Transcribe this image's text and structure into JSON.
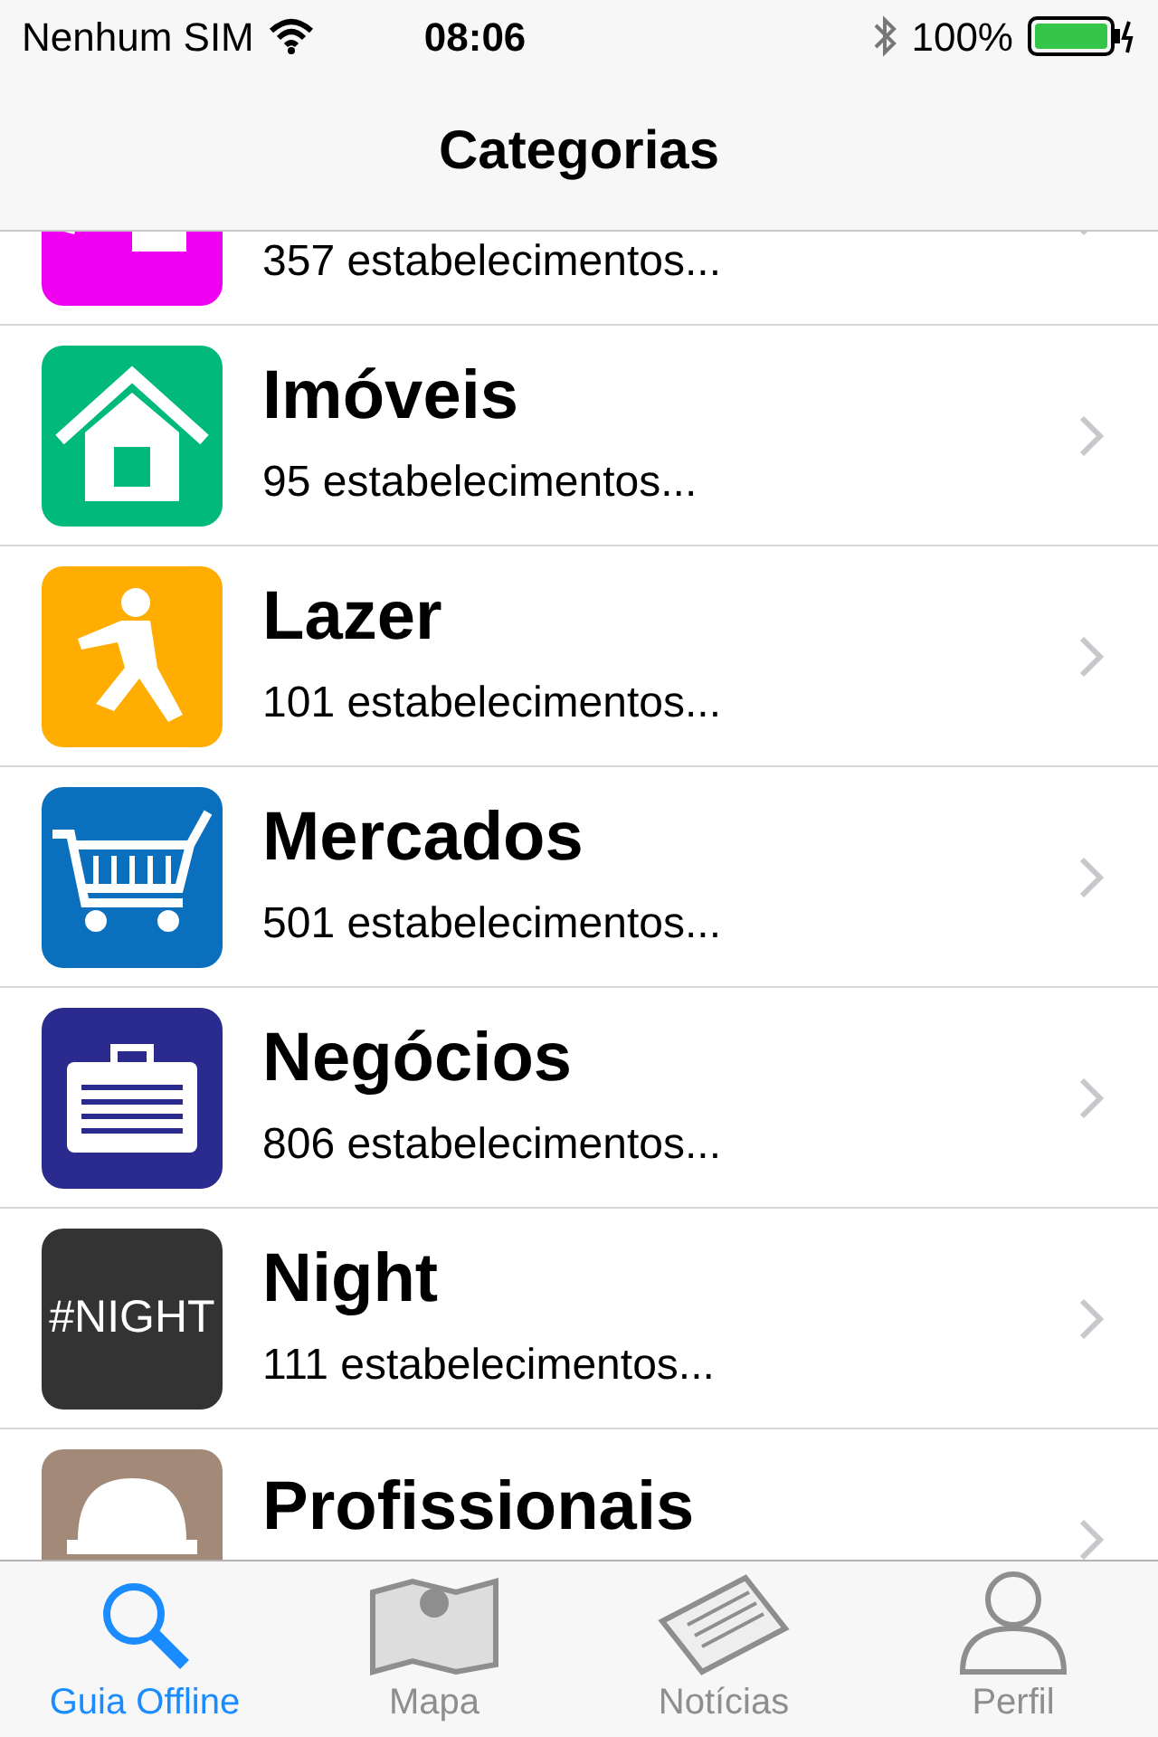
{
  "status_bar": {
    "carrier": "Nenhum SIM",
    "time": "08:06",
    "battery": "100%"
  },
  "nav": {
    "title": "Categorias"
  },
  "categories": [
    {
      "kind": "beauty",
      "color": "#f000f0",
      "count": "357 estabelecimentos..."
    },
    {
      "kind": "house",
      "color": "#00b97a",
      "title": "Imóveis",
      "count": "95 estabelecimentos..."
    },
    {
      "kind": "runner",
      "color": "#ffad00",
      "title": "Lazer",
      "count": "101 estabelecimentos..."
    },
    {
      "kind": "cart",
      "color": "#0a6fbd",
      "title": "Mercados",
      "count": "501 estabelecimentos..."
    },
    {
      "kind": "briefcase",
      "color": "#2b2b8f",
      "title": "Negócios",
      "count": "806 estabelecimentos..."
    },
    {
      "kind": "text",
      "color": "#333333",
      "icon_text": "#NIGHT",
      "title": "Night",
      "count": "111 estabelecimentos..."
    },
    {
      "kind": "helmet",
      "color": "#a38a78",
      "title": "Profissionais"
    }
  ],
  "tabs": [
    {
      "kind": "search",
      "label": "Guia Offline",
      "selected": true
    },
    {
      "kind": "map",
      "label": "Mapa",
      "selected": false
    },
    {
      "kind": "news",
      "label": "Notícias",
      "selected": false
    },
    {
      "kind": "person",
      "label": "Perfil",
      "selected": false
    }
  ]
}
